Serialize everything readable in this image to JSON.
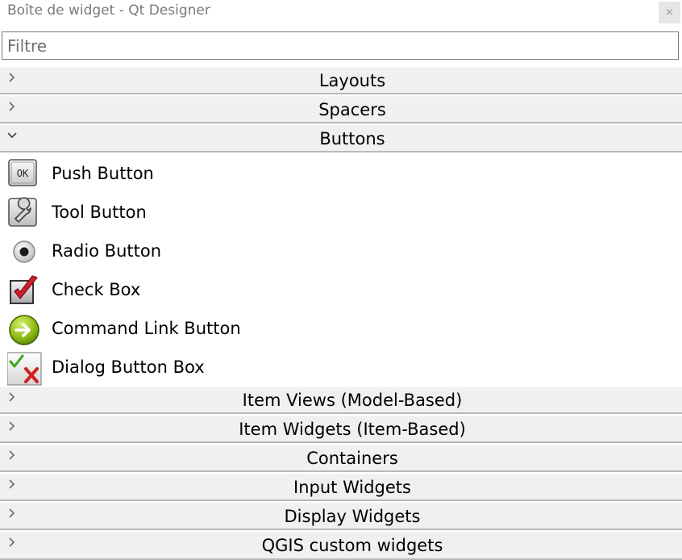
{
  "window": {
    "title": "Boîte de widget - Qt Designer",
    "close_label": "×"
  },
  "filter": {
    "placeholder": "Filtre",
    "value": ""
  },
  "categories": [
    {
      "label": "Layouts",
      "expanded": false
    },
    {
      "label": "Spacers",
      "expanded": false
    },
    {
      "label": "Buttons",
      "expanded": true
    },
    {
      "label": "Item Views (Model-Based)",
      "expanded": false
    },
    {
      "label": "Item Widgets (Item-Based)",
      "expanded": false
    },
    {
      "label": "Containers",
      "expanded": false
    },
    {
      "label": "Input Widgets",
      "expanded": false
    },
    {
      "label": "Display Widgets",
      "expanded": false
    },
    {
      "label": "QGIS custom widgets",
      "expanded": false
    }
  ],
  "buttons_items": [
    {
      "label": "Push Button",
      "icon": "push-button-icon"
    },
    {
      "label": "Tool Button",
      "icon": "tool-button-icon"
    },
    {
      "label": "Radio Button",
      "icon": "radio-button-icon"
    },
    {
      "label": "Check Box",
      "icon": "check-box-icon"
    },
    {
      "label": "Command Link Button",
      "icon": "command-link-icon"
    },
    {
      "label": "Dialog Button Box",
      "icon": "dialog-button-box-icon"
    }
  ],
  "icon_text": {
    "push_button": "OK"
  }
}
